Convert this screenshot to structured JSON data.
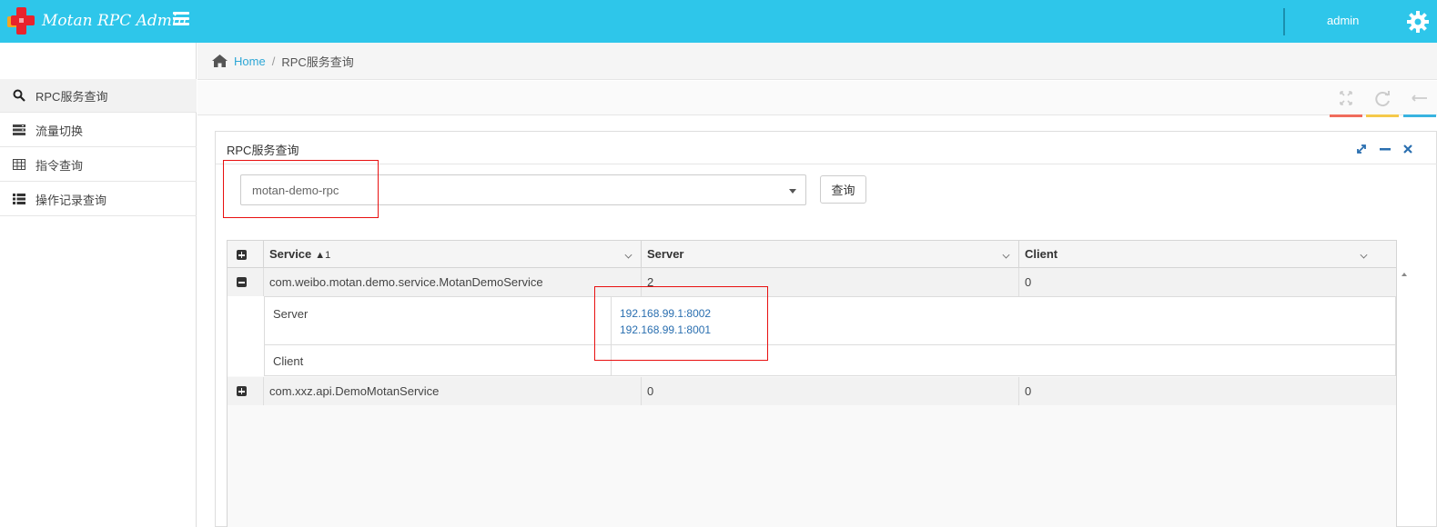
{
  "navbar": {
    "brand_title": "Motan RPC Admin",
    "user_label": "admin",
    "bg_color": "#2ec6ea"
  },
  "sidebar": {
    "items": [
      {
        "label": "RPC服务查询",
        "icon": "search-icon",
        "active": true
      },
      {
        "label": "流量切换",
        "icon": "server-icon",
        "active": false
      },
      {
        "label": "指令查询",
        "icon": "table-icon",
        "active": false
      },
      {
        "label": "操作记录查询",
        "icon": "list-icon",
        "active": false
      }
    ]
  },
  "breadcrumb": {
    "home": "Home",
    "separator": "/",
    "current": "RPC服务查询"
  },
  "toolbar": {
    "buttons": [
      {
        "icon": "expand-icon",
        "accent": "#f06c5c"
      },
      {
        "icon": "refresh-icon",
        "accent": "#f5c94a"
      },
      {
        "icon": "arrows-icon",
        "accent": "#38b3e0"
      }
    ]
  },
  "panel": {
    "title": "RPC服务查询",
    "group_select": {
      "value": "motan-demo-rpc"
    },
    "query_button": "查询"
  },
  "grid": {
    "columns": [
      {
        "label": "Service",
        "sort": "1"
      },
      {
        "label": "Server"
      },
      {
        "label": "Client"
      }
    ],
    "rows": [
      {
        "service": "com.weibo.motan.demo.service.MotanDemoService",
        "server": "2",
        "client": "0",
        "expanded": true
      },
      {
        "service": "com.xxz.api.DemoMotanService",
        "server": "0",
        "client": "0",
        "expanded": false
      }
    ],
    "detail": {
      "server_label": "Server",
      "client_label": "Client",
      "servers": [
        "192.168.99.1:8002",
        "192.168.99.1:8001"
      ]
    }
  }
}
